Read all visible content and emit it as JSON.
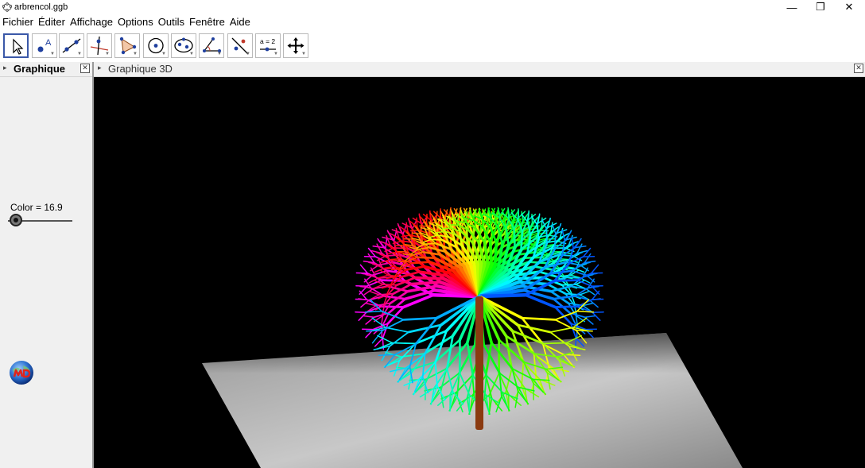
{
  "window": {
    "title": "arbrencol.ggb",
    "minimize_glyph": "—",
    "restore_glyph": "❐",
    "close_glyph": "✕"
  },
  "menu": [
    "Fichier",
    "Éditer",
    "Affichage",
    "Options",
    "Outils",
    "Fenêtre",
    "Aide"
  ],
  "toolbar": {
    "tools": [
      {
        "name": "move-tool-icon",
        "selected": true
      },
      {
        "name": "point-tool-icon"
      },
      {
        "name": "line-tool-icon"
      },
      {
        "name": "perpendicular-line-tool-icon"
      },
      {
        "name": "polygon-tool-icon"
      },
      {
        "name": "circle-tool-icon"
      },
      {
        "name": "ellipse-tool-icon"
      },
      {
        "name": "angle-tool-icon"
      },
      {
        "name": "reflect-tool-icon"
      },
      {
        "name": "slider-tool-icon"
      },
      {
        "name": "move-view-tool-icon"
      }
    ],
    "slider_tool_text": "a = 2",
    "undo_glyph": "↶",
    "redo_glyph": "↷",
    "help_glyph": "?",
    "settings_glyph": "⚙"
  },
  "left_panel": {
    "title": "Graphique",
    "slider": {
      "label": "Color = 16.9",
      "value": 16.9
    }
  },
  "right_panel": {
    "title": "Graphique 3D"
  },
  "close_glyph": "✕",
  "expand_glyph": "▸",
  "colors": {
    "accent": "#3a58a8",
    "view_background": "#000000",
    "trunk": "#8b3a10",
    "panel_background": "#f0f0f0"
  }
}
